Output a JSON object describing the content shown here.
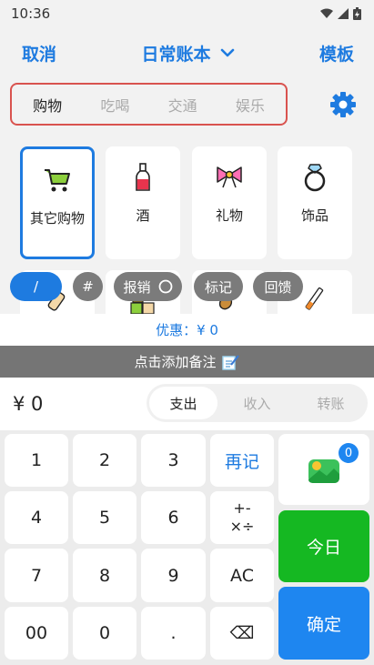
{
  "status_bar": {
    "time": "10:36"
  },
  "header": {
    "cancel_label": "取消",
    "title": "日常账本",
    "template_label": "模板"
  },
  "category_tabs": [
    {
      "label": "购物",
      "active": true
    },
    {
      "label": "吃喝",
      "active": false
    },
    {
      "label": "交通",
      "active": false
    },
    {
      "label": "娱乐",
      "active": false
    }
  ],
  "items": [
    {
      "label": "其它购物",
      "icon": "shopping-cart-icon",
      "selected": true
    },
    {
      "label": "酒",
      "icon": "wine-bottle-icon",
      "selected": false
    },
    {
      "label": "礼物",
      "icon": "gift-bow-icon",
      "selected": false
    },
    {
      "label": "饰品",
      "icon": "ring-icon",
      "selected": false
    }
  ],
  "chips": [
    {
      "label": "/"
    },
    {
      "label": "#"
    },
    {
      "label": "报销"
    },
    {
      "label": "标记"
    },
    {
      "label": "回馈"
    }
  ],
  "discount": {
    "text": "优惠：¥ 0"
  },
  "note": {
    "text": "点击添加备注"
  },
  "amount": {
    "value": "¥ 0"
  },
  "type_tabs": [
    {
      "label": "支出",
      "active": true
    },
    {
      "label": "收入",
      "active": false
    },
    {
      "label": "转账",
      "active": false
    }
  ],
  "keypad": {
    "keys": [
      "1",
      "2",
      "3",
      "再记",
      "4",
      "5",
      "6",
      "+-\n×÷",
      "7",
      "8",
      "9",
      "AC",
      "00",
      "0",
      ".",
      "⌫"
    ],
    "image_badge": "0",
    "today_label": "今日",
    "confirm_label": "确定"
  },
  "colors": {
    "accent": "#1e7be0",
    "green": "#15b822",
    "highlight_border": "#d9534f"
  }
}
